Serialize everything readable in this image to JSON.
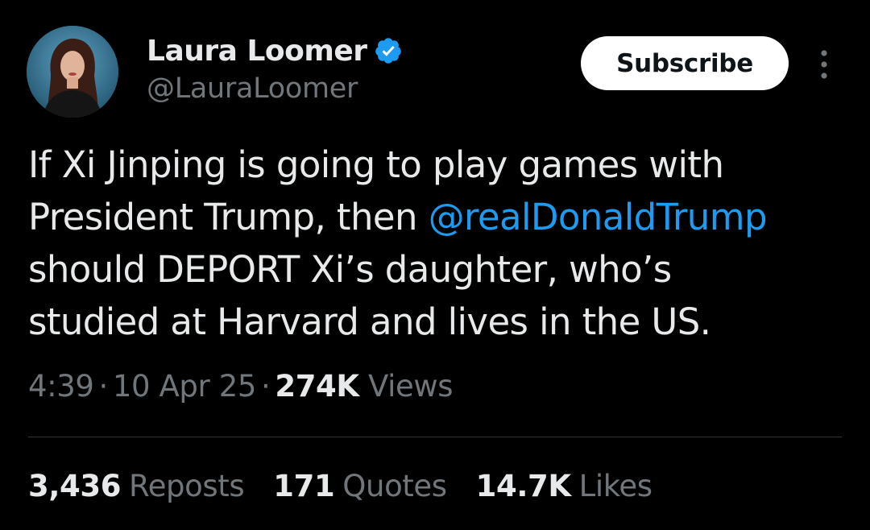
{
  "author": {
    "display_name": "Laura Loomer",
    "handle": "@LauraLoomer",
    "avatar_icon": "profile-photo",
    "verified_icon": "verified-badge-icon",
    "verified_color": "#1d9bf0"
  },
  "actions": {
    "subscribe_label": "Subscribe",
    "more_icon": "more-vertical-icon"
  },
  "tweet": {
    "line1": "If Xi Jinping is going to play games with",
    "line2_before": "President Trump, then ",
    "mention": "@realDonaldTrump",
    "line3": "should DEPORT Xi’s daughter, who’s",
    "line4": "studied at Harvard and lives in the US."
  },
  "meta": {
    "time": "4:39",
    "separator": "·",
    "date": "10 Apr 25",
    "views_count": "274K",
    "views_label": "Views"
  },
  "stats": {
    "reposts_count": "3,436",
    "reposts_label": "Reposts",
    "quotes_count": "171",
    "quotes_label": "Quotes",
    "likes_count": "14.7K",
    "likes_label": "Likes"
  },
  "colors": {
    "background": "#000000",
    "primary_text": "#e7e9ea",
    "secondary_text": "#71767b",
    "link": "#1d9bf0",
    "divider": "#2f3336"
  }
}
